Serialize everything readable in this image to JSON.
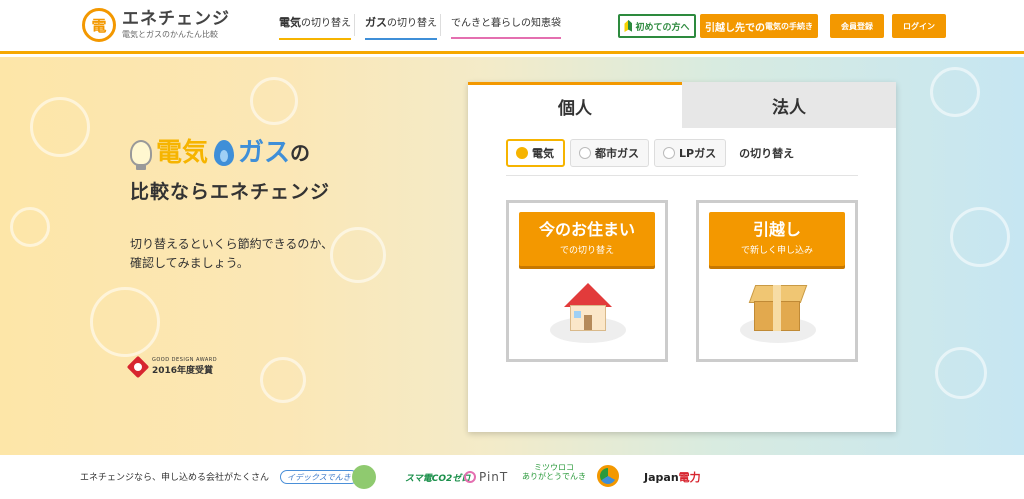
{
  "header": {
    "logo_mark": "電",
    "logo_title": "エネチェンジ",
    "logo_sub": "電気とガスのかんたん比較",
    "nav": [
      {
        "prefix": "電気",
        "suffix": "の切り替え",
        "color": "#f6b400"
      },
      {
        "prefix": "ガス",
        "suffix": "の切り替え",
        "color": "#3f8fd8"
      },
      {
        "prefix": "",
        "suffix": "でんきと暮らしの知恵袋",
        "color": "#e46fb0"
      }
    ],
    "beginner_label": "初めての方へ",
    "moving_label": "引越し先での",
    "moving_label_small": "電気の手続き",
    "signup_label": "会員登録",
    "login_label": "ログイン",
    "accent_color": "#f39800"
  },
  "hero": {
    "catch_elec": "電気",
    "catch_gas": "ガス",
    "catch_no": "の",
    "catch_line2": "比較ならエネチェンジ",
    "desc_line1": "切り替えるといくら節約できるのか、",
    "desc_line2": "確認してみましょう。",
    "award_small": "GOOD DESIGN AWARD",
    "award_year": "2016年度受賞"
  },
  "panel": {
    "tabs": [
      {
        "label": "個人",
        "active": true
      },
      {
        "label": "法人",
        "active": false
      }
    ],
    "energy_options": [
      {
        "label": "電気",
        "selected": true
      },
      {
        "label": "都市ガス",
        "selected": false
      },
      {
        "label": "LPガス",
        "selected": false
      }
    ],
    "energy_suffix": "の切り替え",
    "cards": [
      {
        "title": "今のお住まい",
        "subtitle": "での切り替え",
        "illustration": "house-icon"
      },
      {
        "title": "引越し",
        "subtitle": "で新しく申し込み",
        "illustration": "box-icon"
      }
    ]
  },
  "partners": {
    "label": "エネチェンジなら、申し込める会社がたくさん",
    "logos": [
      {
        "name": "イデックスでんき"
      },
      {
        "name": "character-logo"
      },
      {
        "name": "スマ電CO2ゼロ"
      },
      {
        "name": "PinT"
      },
      {
        "name_line1": "ミツウロコ",
        "name_line2": "ありがとうでんき"
      },
      {
        "name": "circle-logo"
      },
      {
        "name_main": "Japan",
        "name_accent": "電力"
      }
    ]
  }
}
